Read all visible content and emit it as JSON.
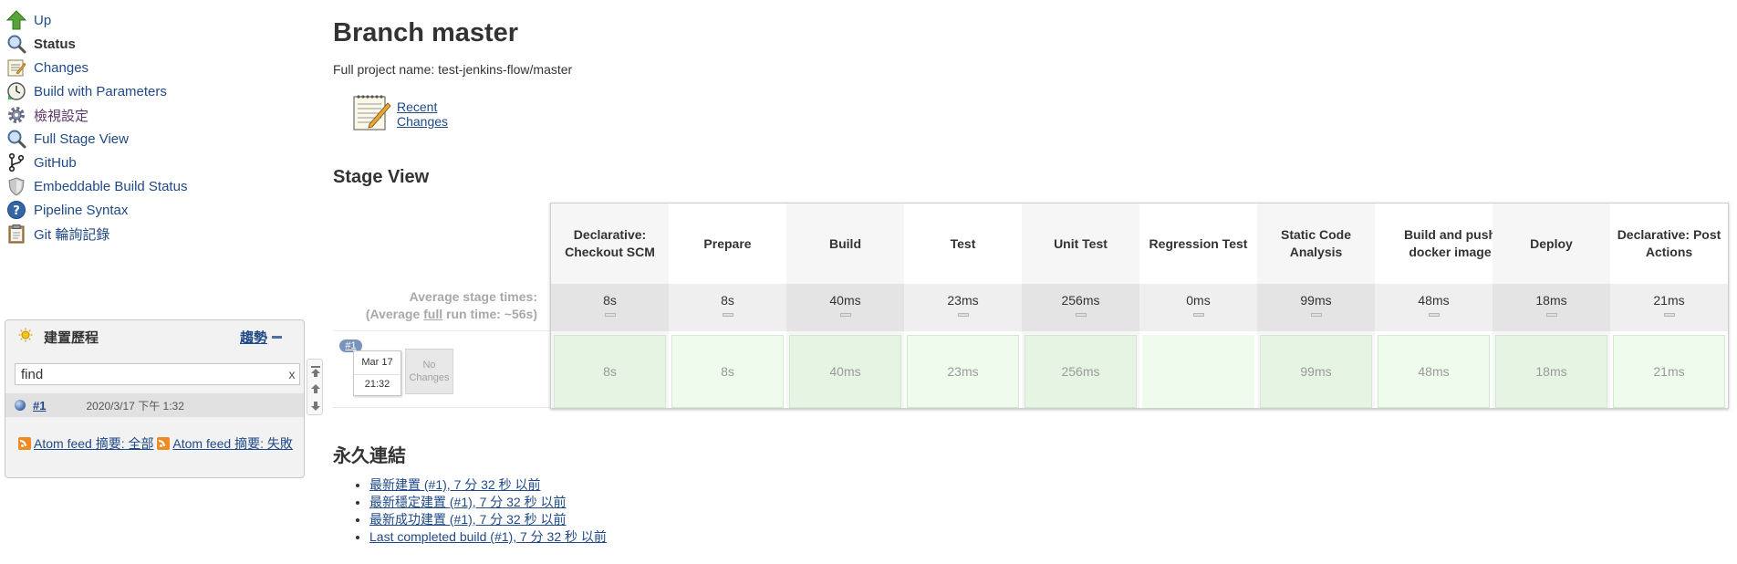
{
  "sidebar": {
    "items": [
      {
        "label": "Up",
        "icon": "up-arrow-icon"
      },
      {
        "label": "Status",
        "icon": "magnifier-icon"
      },
      {
        "label": "Changes",
        "icon": "notepad-icon"
      },
      {
        "label": "Build with Parameters",
        "icon": "clock-icon"
      },
      {
        "label": "檢視設定",
        "icon": "gear-icon"
      },
      {
        "label": "Full Stage View",
        "icon": "magnifier-icon"
      },
      {
        "label": "GitHub",
        "icon": "git-branch-icon"
      },
      {
        "label": "Embeddable Build Status",
        "icon": "shield-icon"
      },
      {
        "label": "Pipeline Syntax",
        "icon": "help-icon"
      },
      {
        "label": "Git 輪詢記錄",
        "icon": "clipboard-icon"
      }
    ]
  },
  "build_history": {
    "title": "建置歷程",
    "trend_label": "趨勢",
    "filter_value": "find",
    "clear_label": "x",
    "builds": [
      {
        "number": "#1",
        "date": "2020/3/17 下午 1:32"
      }
    ],
    "feed_all": "Atom feed 摘要: 全部",
    "feed_fail": "Atom feed 摘要: 失敗"
  },
  "main": {
    "title": "Branch master",
    "full_name": "Full project name: test-jenkins-flow/master",
    "recent_changes": "Recent Changes",
    "stage_view_heading": "Stage View",
    "avg_label_line1": "Average stage times:",
    "avg_label_pre": "(Average ",
    "avg_label_full": "full",
    "avg_label_post": " run time: ~56s)",
    "stages": [
      {
        "name": "Declarative: Checkout SCM",
        "avg": "8s",
        "run": "8s"
      },
      {
        "name": "Prepare",
        "avg": "8s",
        "run": "8s"
      },
      {
        "name": "Build",
        "avg": "40ms",
        "run": "40ms"
      },
      {
        "name": "Test",
        "avg": "23ms",
        "run": "23ms"
      },
      {
        "name": "Unit Test",
        "avg": "256ms",
        "run": "256ms"
      },
      {
        "name": "Regression Test",
        "avg": "0ms",
        "run": ""
      },
      {
        "name": "Static Code Analysis",
        "avg": "99ms",
        "run": "99ms"
      },
      {
        "name": "Build and push docker image",
        "avg": "48ms",
        "run": "48ms"
      },
      {
        "name": "Deploy",
        "avg": "18ms",
        "run": "18ms"
      },
      {
        "name": "Declarative: Post Actions",
        "avg": "21ms",
        "run": "21ms"
      }
    ],
    "run": {
      "badge": "#1",
      "date": "Mar 17",
      "time": "21:32",
      "changes": "No Changes"
    },
    "permalinks_heading": "永久連結",
    "permalinks": [
      "最新建置 (#1), 7 分 32 秒 以前",
      "最新穩定建置 (#1), 7 分 32 秒 以前",
      "最新成功建置 (#1), 7 分 32 秒 以前",
      "Last completed build (#1), 7 分 32 秒 以前"
    ]
  }
}
